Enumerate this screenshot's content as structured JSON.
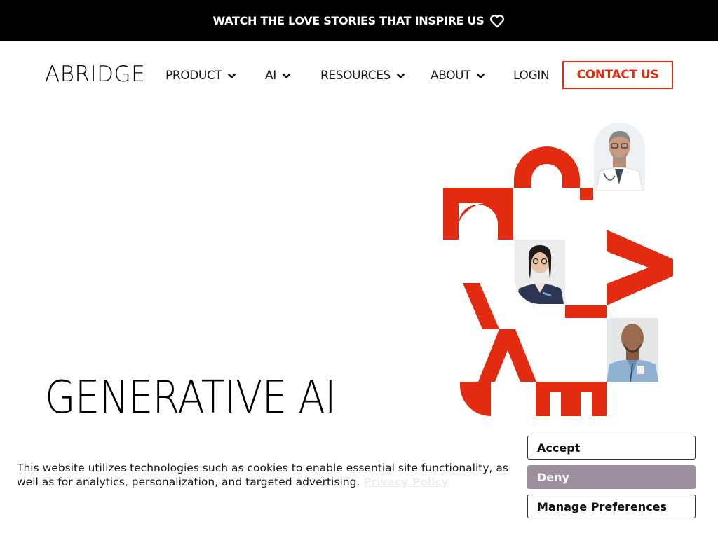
{
  "announcement": {
    "text": "WATCH THE LOVE STORIES THAT INSPIRE US",
    "icon": "heart-outline-icon"
  },
  "header": {
    "logo": "ABRIDGE",
    "nav": [
      {
        "label": "PRODUCT",
        "icon": "chevron-down-icon"
      },
      {
        "label": "AI",
        "icon": "chevron-down-icon"
      },
      {
        "label": "RESOURCES",
        "icon": "chevron-down-icon"
      },
      {
        "label": "ABOUT",
        "icon": "chevron-down-icon"
      },
      {
        "label": "LOGIN"
      }
    ],
    "cta": "CONTACT US"
  },
  "hero": {
    "title": "GENERATIVE AI"
  },
  "cookie_banner": {
    "text": "This website utilizes technologies such as cookies to enable essential site functionality, as well as for analytics, personalization, and targeted advertising.",
    "link": "Privacy Policy",
    "buttons": {
      "accept": "Accept",
      "deny": "Deny",
      "manage": "Manage Preferences"
    }
  },
  "colors": {
    "brand_red": "#e32b12",
    "deny_bg": "#9e8f9e",
    "announcement_bg": "#000000"
  }
}
